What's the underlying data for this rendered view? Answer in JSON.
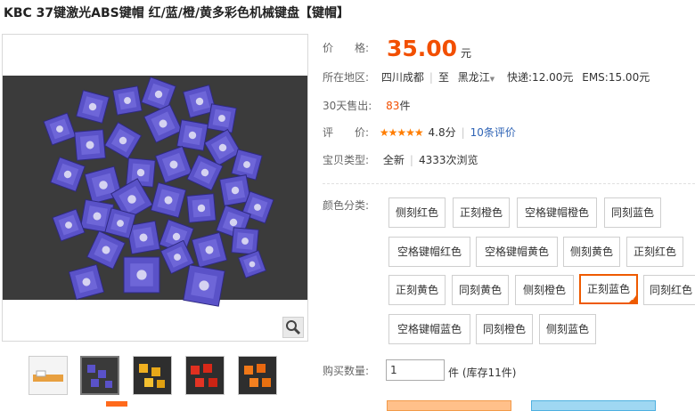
{
  "product": {
    "title": "KBC 37键激光ABS键帽 红/蓝/橙/黄多彩色机械键盘【键帽】"
  },
  "price": {
    "label": "价　　格:",
    "value": "35.00",
    "unit": "元"
  },
  "location": {
    "label": "所在地区:",
    "from": "四川成都",
    "to_prefix": "至",
    "to": "黑龙江",
    "express": "快递:12.00元",
    "ems": "EMS:15.00元"
  },
  "sales": {
    "label": "30天售出:",
    "count": "83",
    "unit": "件"
  },
  "rating": {
    "label": "评　　价:",
    "stars": "★★★★★",
    "score": "4.8分",
    "reviews": "10条评价"
  },
  "condition": {
    "label": "宝贝类型:",
    "type": "全新",
    "views": "4333次浏览"
  },
  "color_options": {
    "label": "颜色分类:",
    "items": [
      "侧刻红色",
      "正刻橙色",
      "空格键帽橙色",
      "同刻蓝色",
      "空格键帽红色",
      "空格键帽黄色",
      "侧刻黄色",
      "正刻红色",
      "正刻黄色",
      "同刻黄色",
      "侧刻橙色",
      "正刻蓝色",
      "同刻红色",
      "空格键帽蓝色",
      "同刻橙色",
      "侧刻蓝色"
    ],
    "selected": "正刻蓝色"
  },
  "quantity": {
    "label": "购买数量:",
    "value": "1",
    "stock": "件 (库存11件)"
  },
  "colors": {
    "price": "#f24f00",
    "accent": "#ee5a00",
    "link": "#2e63b5",
    "keycap_blue": "#5a52c8"
  },
  "icons": {
    "zoom": "magnifier-icon",
    "selected_check": "check-corner-icon",
    "dropdown": "chevron-down-icon"
  }
}
